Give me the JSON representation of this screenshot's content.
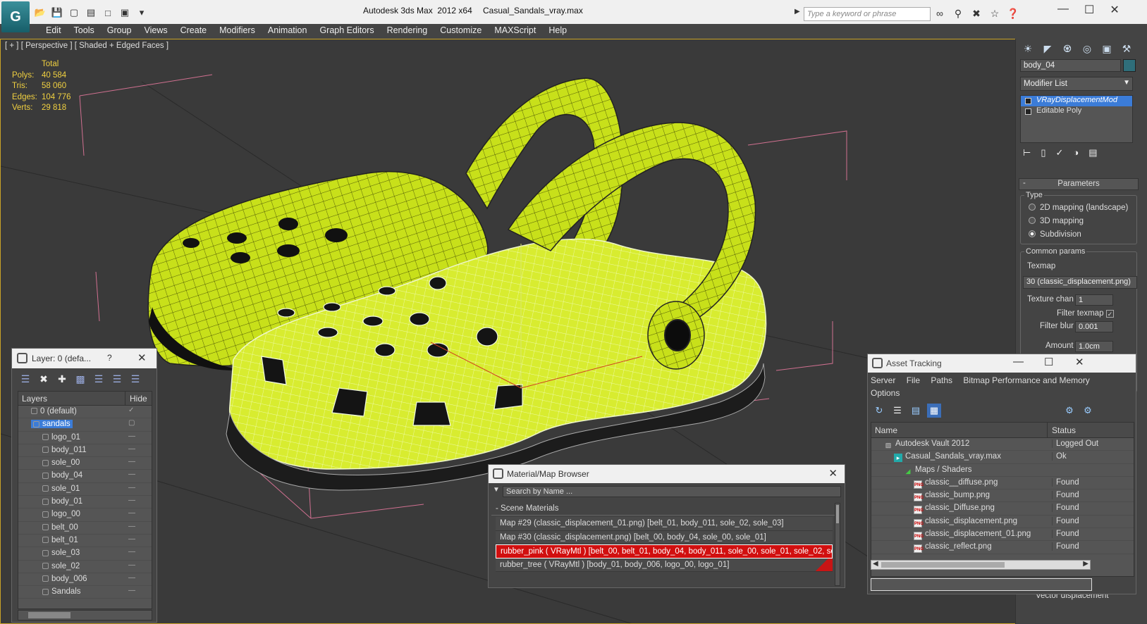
{
  "title_bar": {
    "app_title": "Autodesk 3ds Max  2012 x64",
    "file_name": "Casual_Sandals_vray.max",
    "search_placeholder": "Type a keyword or phrase"
  },
  "menu": [
    "Edit",
    "Tools",
    "Group",
    "Views",
    "Create",
    "Modifiers",
    "Animation",
    "Graph Editors",
    "Rendering",
    "Customize",
    "MAXScript",
    "Help"
  ],
  "viewport": {
    "label": "[ + ] [ Perspective ] [ Shaded + Edged Faces ]",
    "stats_header": "Total",
    "stats": [
      {
        "label": "Polys:",
        "value": "40 584"
      },
      {
        "label": "Tris:",
        "value": "58 060"
      },
      {
        "label": "Edges:",
        "value": "104 776"
      },
      {
        "label": "Verts:",
        "value": "29 818"
      }
    ],
    "model_color": "#c8e01a"
  },
  "layer_dialog": {
    "title": "Layer: 0 (defa...",
    "help": "?",
    "col_layers": "Layers",
    "col_hide": "Hide",
    "rows": [
      {
        "name": "0 (default)",
        "depth": 0,
        "checked": true
      },
      {
        "name": "sandals",
        "depth": 0,
        "selected": true
      },
      {
        "name": "logo_01",
        "depth": 1
      },
      {
        "name": "body_011",
        "depth": 1
      },
      {
        "name": "sole_00",
        "depth": 1
      },
      {
        "name": "body_04",
        "depth": 1
      },
      {
        "name": "sole_01",
        "depth": 1
      },
      {
        "name": "body_01",
        "depth": 1
      },
      {
        "name": "logo_00",
        "depth": 1
      },
      {
        "name": "belt_00",
        "depth": 1
      },
      {
        "name": "belt_01",
        "depth": 1
      },
      {
        "name": "sole_03",
        "depth": 1
      },
      {
        "name": "sole_02",
        "depth": 1
      },
      {
        "name": "body_006",
        "depth": 1
      },
      {
        "name": "Sandals",
        "depth": 1
      }
    ]
  },
  "command_panel": {
    "object_name": "body_04",
    "modifier_list": "Modifier List",
    "stack": [
      "VRayDisplacementMod",
      "Editable Poly"
    ],
    "parameters_title": "Parameters",
    "type_label": "Type",
    "type_options": [
      {
        "label": "2D mapping (landscape)",
        "selected": false
      },
      {
        "label": "3D mapping",
        "selected": false
      },
      {
        "label": "Subdivision",
        "selected": true
      }
    ],
    "common_params": "Common params",
    "texmap_label": "Texmap",
    "texmap_value": "30 (classic_displacement.png)",
    "texture_chan_label": "Texture chan",
    "texture_chan_value": "1",
    "filter_texmap_label": "Filter texmap",
    "filter_blur_label": "Filter blur",
    "filter_blur_value": "0.001",
    "amount_label": "Amount",
    "amount_value": "1.0cm",
    "vector_disp": "Vector displacement"
  },
  "material_browser": {
    "title": "Material/Map Browser",
    "search_placeholder": "Search by Name ...",
    "group": "- Scene Materials",
    "rows": [
      {
        "text": "Map #29 (classic_displacement_01.png)  [belt_01, body_011, sole_02, sole_03]",
        "selected": false
      },
      {
        "text": "Map #30 (classic_displacement.png)  [belt_00, body_04, sole_00, sole_01]",
        "selected": false
      },
      {
        "text": "rubber_pink  ( VRayMtl )  [belt_00, belt_01, body_04, body_011, sole_00, sole_01, sole_02, so...",
        "selected": true
      },
      {
        "text": "rubber_tree  ( VRayMtl )  [body_01, body_006, logo_00, logo_01]",
        "selected": false
      }
    ]
  },
  "asset_tracking": {
    "title": "Asset Tracking",
    "menu": [
      "Server",
      "File",
      "Paths",
      "Bitmap Performance and Memory",
      "Options"
    ],
    "col_name": "Name",
    "col_status": "Status",
    "rows": [
      {
        "name": "Autodesk Vault 2012",
        "status": "Logged Out",
        "indent": 1,
        "icon": "vault"
      },
      {
        "name": "Casual_Sandals_vray.max",
        "status": "Ok",
        "indent": 2,
        "icon": "max"
      },
      {
        "name": "Maps / Shaders",
        "status": "",
        "indent": 3,
        "icon": "maps"
      },
      {
        "name": "classic__diffuse.png",
        "status": "Found",
        "indent": 4,
        "icon": "png"
      },
      {
        "name": "classic_bump.png",
        "status": "Found",
        "indent": 4,
        "icon": "png"
      },
      {
        "name": "classic_Diffuse.png",
        "status": "Found",
        "indent": 4,
        "icon": "png"
      },
      {
        "name": "classic_displacement.png",
        "status": "Found",
        "indent": 4,
        "icon": "png"
      },
      {
        "name": "classic_displacement_01.png",
        "status": "Found",
        "indent": 4,
        "icon": "png"
      },
      {
        "name": "classic_reflect.png",
        "status": "Found",
        "indent": 4,
        "icon": "png"
      }
    ]
  }
}
